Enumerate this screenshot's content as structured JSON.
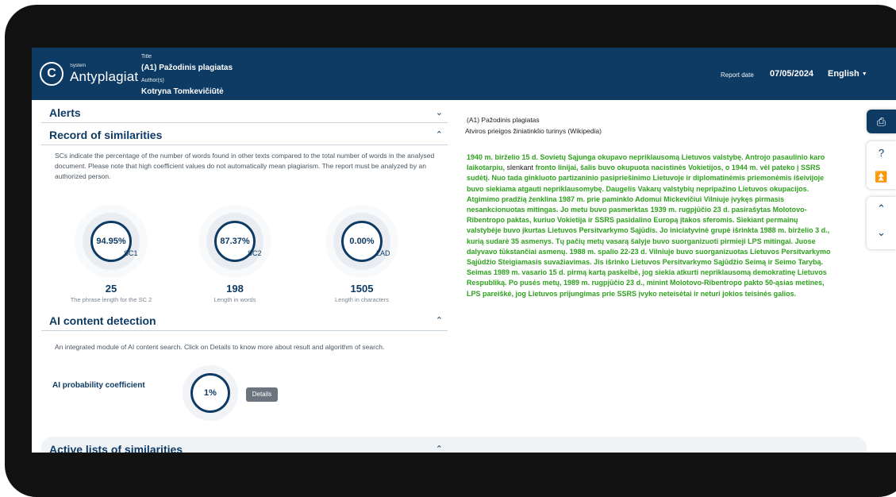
{
  "header": {
    "system_label": "System",
    "brand": "Antyplagiat",
    "title_label": "Title",
    "title_value": "(A1) Pažodinis plagiatas",
    "author_label": "Author(s)",
    "author_value": "Kotryna Tomkevičiūtė",
    "report_date_label": "Report date",
    "report_date_value": "07/05/2024",
    "language": "English"
  },
  "sections": {
    "alerts": "Alerts",
    "record": "Record of similarities",
    "ai": "AI content detection",
    "active": "Active lists of similarities"
  },
  "record": {
    "description": "SCs indicate the percentage of the number of words found in other texts compared to the total number of words in the analysed document. Please note that high coefficient values do not automatically mean plagiarism. The report must be analyzed by an authorized person.",
    "gauges": [
      {
        "value": "94.95%",
        "tag": "SC1"
      },
      {
        "value": "87.37%",
        "tag": "SC2"
      },
      {
        "value": "0.00%",
        "tag": "LAD"
      }
    ],
    "stats": [
      {
        "value": "25",
        "label": "The phrase length for the SC 2"
      },
      {
        "value": "198",
        "label": "Length in words"
      },
      {
        "value": "1505",
        "label": "Length in characters"
      }
    ]
  },
  "ai": {
    "description": "An integrated module of AI content search. Click on Details to know more about result and algorithm of search.",
    "coef_label": "AI probability coefficient",
    "coef_value": "1%",
    "details": "Details"
  },
  "document": {
    "title": "(A1) Pažodinis plagiatas",
    "subtitle": "Atviros prieigos žiniatinklio turinys (Wikipedia)",
    "p1": "1940 m. birželio 15 d. Sovietų Sąjunga okupavo nepriklausomą Lietuvos valstybę. Antrojo pasaulinio karo laikotarpiu, ",
    "p1_plain": "slenkant ",
    "p1b": "fronto linijai, šalis buvo okupuota nacistinės Vokietijos, o 1944 m. vėl pateko į SSRS sudėtį. Nuo tada ginkluoto partizaninio pasipriešinimo Lietuvoje ir diplomatinėmis priemonėmis išeivijoje buvo siekiama atgauti nepriklausomybę. Daugelis Vakarų valstybių nepripažino Lietuvos okupacijos. Atgimimo pradžią ženklina 1987 m. prie paminklo Adomui Mickevičiui Vilniuje įvykęs pirmasis nesankcionuotas mitingas. Jo metu buvo pasmerktas 1939 m. rugpjūčio 23 d. pasirašytas Molotovo-Ribentropo paktas, kuriuo Vokietija ir SSRS pasidalino Europą įtakos sferomis.",
    "p2": " Siekiant permainų valstybėje buvo įkurtas Lietuvos Persitvarkymo Sąjūdis. Jo iniciatyvinė grupė išrinkta 1988 m. birželio 3 d., kurią sudarė 35 asmenys. Tų pačių metų vasarą šalyje buvo suorganizuoti pirmieji LPS mitingai. Juose dalyvavo tūkstančiai asmenų.",
    "p3": " 1988 m. spalio 22-23 d. Vilniuje buvo suorganizuotas Lietuvos Persitvarkymo Sąjūdžio Steigiamasis suvažiavimas. Jis išrinko Lietuvos Persitvarkymo Sąjūdžio Seimą ir Seimo Tarybą. Seimas 1989 m. vasario 15 d. pirmą kartą paskelbė, jog siekia atkurti nepriklausomą demokratinę Lietuvos Respubliką.",
    "p4": " Po pusės metų, 1989 m. rugpjūčio 23 d., minint Molotovo-Ribentropo pakto 50-ąsias metines, LPS pareiškė, jog Lietuvos prijungimas prie SSRS įvyko neteisėtai ir neturi jokios teisinės galios."
  },
  "colors": {
    "header": "#0e3b63",
    "match_text": "#2fa11f",
    "details_button": "#6c757d"
  },
  "toolbar": {
    "print": "printer-icon",
    "help": "help-icon",
    "top": "double-chevron-up-icon",
    "prev": "chevron-up-icon",
    "next": "chevron-down-icon"
  }
}
